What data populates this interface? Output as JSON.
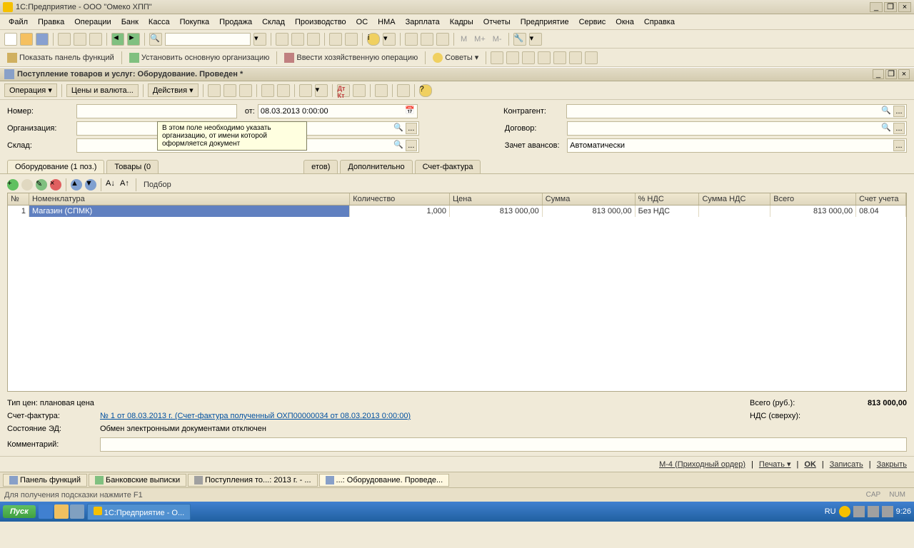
{
  "window": {
    "title": "1С:Предприятие - ООО \"Омеко ХПП\""
  },
  "menu": [
    "Файл",
    "Правка",
    "Операции",
    "Банк",
    "Касса",
    "Покупка",
    "Продажа",
    "Склад",
    "Производство",
    "ОС",
    "НМА",
    "Зарплата",
    "Кадры",
    "Отчеты",
    "Предприятие",
    "Сервис",
    "Окна",
    "Справка"
  ],
  "toolbar2": {
    "show_panel": "Показать панель функций",
    "set_org": "Установить основную организацию",
    "enter_op": "Ввести хозяйственную операцию",
    "tips": "Советы"
  },
  "doc": {
    "title": "Поступление товаров и услуг: Оборудование. Проведен *",
    "operation": "Операция",
    "prices": "Цены и валюта...",
    "actions": "Действия"
  },
  "labels": {
    "number": "Номер:",
    "from": "от:",
    "date": "08.03.2013  0:00:00",
    "org": "Организация:",
    "warehouse": "Склад:",
    "contractor": "Контрагент:",
    "contract": "Договор:",
    "advance": "Зачет авансов:",
    "advance_val": "Автоматически",
    "tooltip": "В этом поле необходимо указать организацию, от имени которой оформляется документ"
  },
  "tabs": [
    "Оборудование (1 поз.)",
    "Товары (0",
    "етов)",
    "Дополнительно",
    "Счет-фактура"
  ],
  "rowtools": {
    "select": "Подбор"
  },
  "grid": {
    "headers": [
      "№",
      "Номенклатура",
      "Количество",
      "Цена",
      "Сумма",
      "% НДС",
      "Сумма НДС",
      "Всего",
      "Счет учета"
    ],
    "row": {
      "n": "1",
      "name": "Магазин (СПМК)",
      "qty": "1,000",
      "price": "813 000,00",
      "sum": "813 000,00",
      "vat": "Без НДС",
      "vatsum": "",
      "total": "813 000,00",
      "acc": "08.04"
    }
  },
  "footer": {
    "pricetype_lbl": "Тип цен: плановая цена",
    "total_lbl": "Всего (руб.):",
    "total_val": "813 000,00",
    "invoice_lbl": "Счет-фактура:",
    "invoice_link": "№ 1 от 08.03.2013 г. (Счет-фактура полученный ОХП00000034 от 08.03.2013 0:00:00)",
    "vat_top_lbl": "НДС (сверху):",
    "ed_state_lbl": "Состояние ЭД:",
    "ed_state_val": "Обмен электронными документами отключен",
    "comment_lbl": "Комментарий:"
  },
  "actions": {
    "m4": "М-4 (Приходный ордер)",
    "print": "Печать",
    "ok": "OK",
    "save": "Записать",
    "close": "Закрыть"
  },
  "windows": [
    "Панель функций",
    "Банковские выписки",
    "Поступления то...: 2013 г. - ...",
    "...:  Оборудование. Проведе..."
  ],
  "status": {
    "msg": "Для получения подсказки нажмите F1",
    "cap": "CAP",
    "num": "NUM"
  },
  "taskbar": {
    "start": "Пуск",
    "app": "1С:Предприятие - О...",
    "lang": "RU",
    "time": "9:26"
  }
}
